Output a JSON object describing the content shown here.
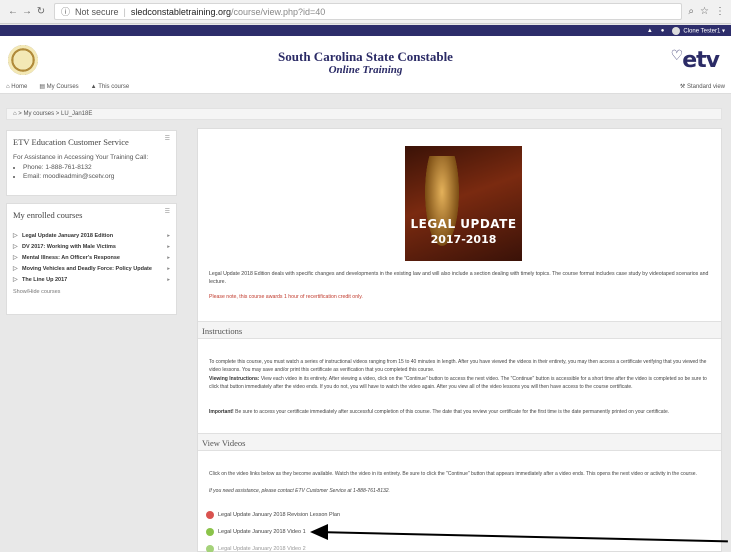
{
  "browser": {
    "security_label": "Not secure",
    "domain": "sledconstabletraining.org",
    "path": "/course/view.php?id=40"
  },
  "userbar": {
    "user": "Clone Tester1"
  },
  "header": {
    "title": "South Carolina State Constable",
    "subtitle": "Online Training",
    "logo_text": "etv"
  },
  "nav": {
    "home": "Home",
    "my_courses": "My Courses",
    "this_course": "This course",
    "standard_view": "Standard view"
  },
  "breadcrumb": "My courses  >  LU_Jan18E",
  "support_block": {
    "title": "ETV Education Customer Service",
    "intro": "For Assistance in Accessing Your Training Call:",
    "phone": "Phone: 1-888-761-8132",
    "email": "Email: moodleadmin@scetv.org"
  },
  "courses_block": {
    "title": "My enrolled courses",
    "items": [
      "Legal Update January 2018 Edition",
      "DV 2017: Working with Male Victims",
      "Mental Illness: An Officer's Response",
      "Moving Vehicles and Deadly Force: Policy Update",
      "The Line Up 2017"
    ],
    "show_hide": "Show/Hide courses"
  },
  "cover": {
    "line1": "LEGAL UPDATE",
    "line2": "2017-2018"
  },
  "main": {
    "description": "Legal Update 2018 Edition deals with specific changes and developments in the existing law and will also include a section dealing with timely topics. The course format includes case study by videotaped scenarios and lecture.",
    "credit_note": "Please note, this course awards 1 hour of recertification credit only.",
    "instructions_title": "Instructions",
    "instr_p1": "To complete this course, you must watch a series of instructional videos ranging from 15 to 40 minutes in length. After you have viewed the videos in their entirety, you may then access a certificate verifying that you viewed the video lessons. You may save and/or print this certificate as verification that you completed this course.",
    "instr_p2_label": "Viewing Instructions:",
    "instr_p2": "View each video in its entirety. After viewing a video, click on the \"Continue\" button to access the next video. The \"Continue\" button is accessible for a short time after the video is completed so be sure to click that button immediately after the video ends. If you do not, you will have to watch the video again. After you view all of the video lessons you will then have access to the course certificate.",
    "instr_p3_label": "Important!",
    "instr_p3": "Be sure to access your certificate immediately after successful completion of this course. The date that you review your certificate for the first time is the date permanently printed on your certificate.",
    "videos_title": "View Videos",
    "videos_p1": "Click on the video links below as they become available. Watch the video in its entirety. Be sure to click the \"Continue\" button that appears immediately after a video ends. This opens the next video or activity in the course.",
    "videos_p2": "If you need assistance, please contact ETV Customer Service at 1-888-761-8132.",
    "activities": [
      {
        "label": "Legal Update January 2018 Revision Lesson Plan",
        "color": "#d9534f"
      },
      {
        "label": "Legal Update January 2018 Video 1",
        "color": "#8bc34a"
      },
      {
        "label": "Legal Update January 2018 Video 2",
        "color": "#8bc34a"
      }
    ]
  }
}
